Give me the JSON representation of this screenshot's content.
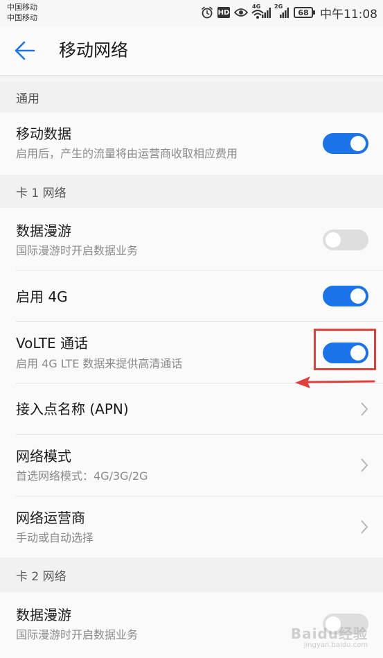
{
  "status_bar": {
    "carrier_1": "中国移动",
    "carrier_2": "中国移动",
    "hd_label": "HD",
    "sim1_network": "4G",
    "sim2_network": "2G",
    "battery": "68",
    "time": "中午11:08",
    "icons": [
      "alarm-icon",
      "hd-icon",
      "eye-icon",
      "wifi-icon",
      "signal-icon",
      "battery-icon"
    ]
  },
  "toolbar": {
    "title": "移动网络",
    "back_icon": "arrow-left-icon",
    "accent_color": "#1a73e8"
  },
  "sections": {
    "general": "通用",
    "card1": "卡 1 网络",
    "card2": "卡 2 网络"
  },
  "items": {
    "mobile_data": {
      "title": "移动数据",
      "subtitle": "启用后，产生的流量将由运营商收取相应费用",
      "toggle_on": true
    },
    "data_roaming_1": {
      "title": "数据漫游",
      "subtitle": "国际漫游时开启数据业务",
      "toggle_on": false
    },
    "enable_4g": {
      "title": "启用 4G",
      "toggle_on": true
    },
    "volte": {
      "title": "VoLTE 通话",
      "subtitle": "启用 4G LTE 数据来提供高清通话",
      "toggle_on": true
    },
    "apn": {
      "title": "接入点名称 (APN)"
    },
    "network_mode": {
      "title": "网络模式",
      "subtitle": "首选网络模式：4G/3G/2G"
    },
    "network_operator": {
      "title": "网络运营商",
      "subtitle": "手动或自动选择"
    },
    "data_roaming_2": {
      "title": "数据漫游",
      "subtitle": "国际漫游时开启数据业务",
      "toggle_on": false
    }
  },
  "annotation": {
    "highlight_color": "#e0413f"
  },
  "watermark": {
    "brand": "Baidu经验",
    "url": "jingyan.baidu.com"
  }
}
